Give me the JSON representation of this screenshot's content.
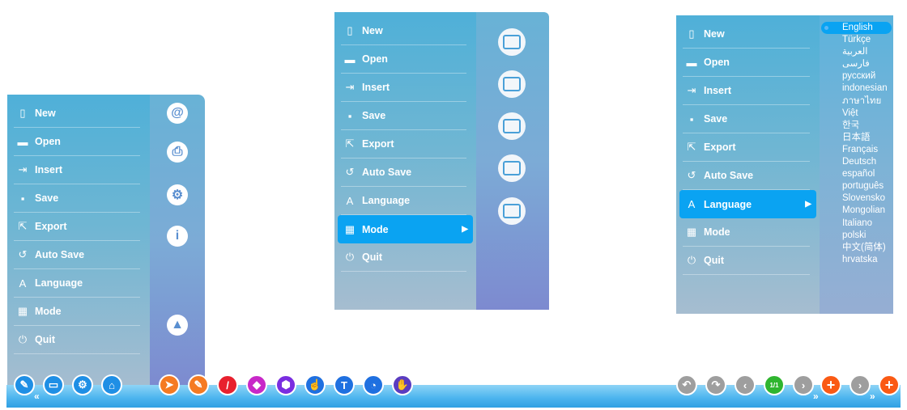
{
  "menu": {
    "items": [
      {
        "label": "New",
        "icon": "page-icon"
      },
      {
        "label": "Open",
        "icon": "folder-icon"
      },
      {
        "label": "Insert",
        "icon": "insert-icon"
      },
      {
        "label": "Save",
        "icon": "floppy-icon"
      },
      {
        "label": "Export",
        "icon": "export-icon"
      },
      {
        "label": "Auto Save",
        "icon": "history-icon"
      },
      {
        "label": "Language",
        "icon": "language-icon"
      },
      {
        "label": "Mode",
        "icon": "grid-icon"
      },
      {
        "label": "Quit",
        "icon": "power-icon"
      }
    ]
  },
  "panel1": {
    "side_icons": [
      "at-icon",
      "printer-icon",
      "settings-icon",
      "info-icon",
      "android-icon"
    ],
    "side_glyphs": [
      "@",
      "⎙",
      "⚙",
      "i",
      "▲"
    ]
  },
  "panel2": {
    "selected": "Mode",
    "mode_icons": [
      "presentation-screen-icon",
      "window-icon",
      "desktop-monitor-icon",
      "pen-edit-icon",
      "teacher-icon"
    ]
  },
  "panel3": {
    "selected": "Language",
    "languages": [
      "English",
      "Türkçe",
      "العربية",
      "فارسی",
      "русский",
      "indonesian",
      "ภาษาไทย",
      "Việt",
      "한국",
      "日本語",
      "Français",
      "Deutsch",
      "español",
      "português",
      "Slovensko",
      "Mongolian",
      "Italiano",
      "polski",
      "中文(简体)",
      "hrvatska"
    ],
    "selected_language": "English"
  },
  "toolbar": {
    "left_tools": [
      {
        "name": "whiteboard-edit-icon",
        "glyph": "✎",
        "color": "blue"
      },
      {
        "name": "screen-icon",
        "glyph": "▭",
        "color": "blue"
      },
      {
        "name": "settings-icon",
        "glyph": "⚙",
        "color": "blue"
      },
      {
        "name": "folder-open-icon",
        "glyph": "⌂",
        "color": "blue"
      }
    ],
    "draw_tools": [
      {
        "name": "select-arrow-icon",
        "glyph": "➤",
        "color": "orange"
      },
      {
        "name": "pencil-icon",
        "glyph": "✎",
        "color": "orange"
      },
      {
        "name": "line-icon",
        "glyph": "/",
        "color": "red"
      },
      {
        "name": "eraser-icon",
        "glyph": "◆",
        "color": "magenta"
      },
      {
        "name": "shape-icon",
        "glyph": "⬢",
        "color": "purple"
      },
      {
        "name": "hand-touch-icon",
        "glyph": "☝",
        "color": "blue2"
      },
      {
        "name": "text-icon",
        "glyph": "T",
        "color": "blue2"
      },
      {
        "name": "fill-icon",
        "glyph": "◔",
        "color": "blue2"
      },
      {
        "name": "pan-hand-icon",
        "glyph": "✋",
        "color": "violet"
      }
    ],
    "page_indicator": "1/1",
    "undo_glyph": "↶",
    "redo_glyph": "↷",
    "prev_glyph": "‹",
    "next_glyph": "›",
    "add_glyph": "+",
    "collapse_glyph": "«",
    "expand_glyph": "»"
  },
  "colors": {
    "accent": "#0aa3f2",
    "menu_bg": "#5fb2d8",
    "toolbar": "#3aa8ea"
  }
}
